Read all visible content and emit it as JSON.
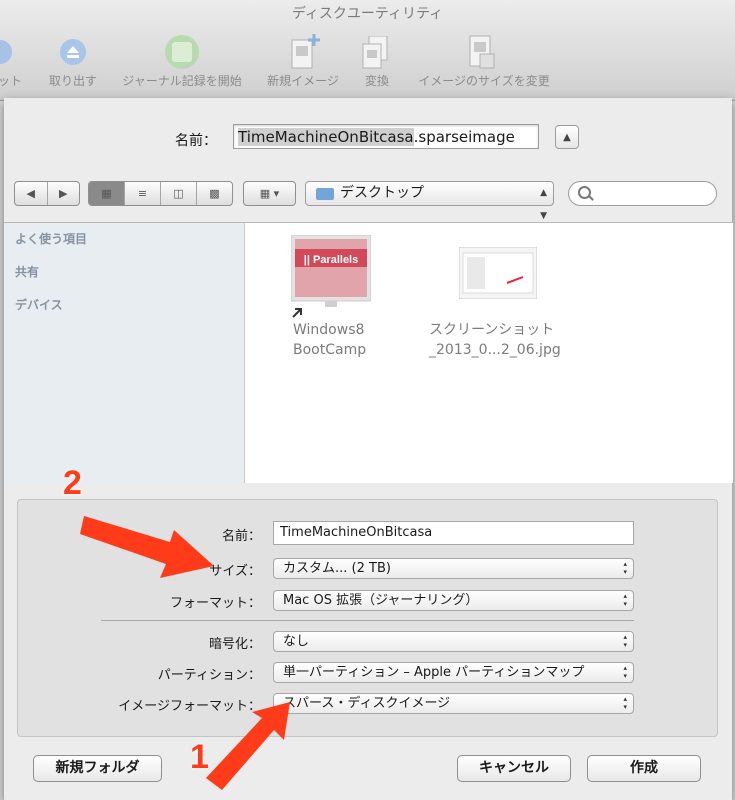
{
  "window": {
    "title": "ディスクユーティリティ"
  },
  "toolbar": {
    "items": [
      {
        "label": "ット"
      },
      {
        "label": "取り出す"
      },
      {
        "label": "ジャーナル記録を開始"
      },
      {
        "label": "新規イメージ"
      },
      {
        "label": "変換"
      },
      {
        "label": "イメージのサイズを変更"
      }
    ]
  },
  "save_as": {
    "label": "名前：",
    "value_selected": "TimeMachineOnBitcasa",
    "value_ext": ".sparseimage"
  },
  "browser": {
    "location": "デスクトップ",
    "sidebar": [
      "よく使う項目",
      "共有",
      "デバイス"
    ],
    "files": [
      {
        "name_line1": "Windows8",
        "name_line2": "BootCamp",
        "icon_text": "|| Parallels"
      },
      {
        "name_line1": "スクリーンショット",
        "name_line2": "_2013_0...2_06.jpg"
      }
    ]
  },
  "options": {
    "name_label": "名前：",
    "name_value": "TimeMachineOnBitcasa",
    "size_label": "サイズ：",
    "size_value": "カスタム... (2 TB)",
    "format_label": "フォーマット：",
    "format_value": "Mac OS 拡張（ジャーナリング）",
    "encryption_label": "暗号化：",
    "encryption_value": "なし",
    "partition_label": "パーティション：",
    "partition_value": "単一パーティション – Apple パーティションマップ",
    "image_format_label": "イメージフォーマット：",
    "image_format_value": "スパース・ディスクイメージ"
  },
  "buttons": {
    "new_folder": "新規フォルダ",
    "cancel": "キャンセル",
    "create": "作成"
  },
  "annotations": {
    "marker_1": "1",
    "marker_2": "2",
    "arrow_color": "#ff3b19"
  }
}
